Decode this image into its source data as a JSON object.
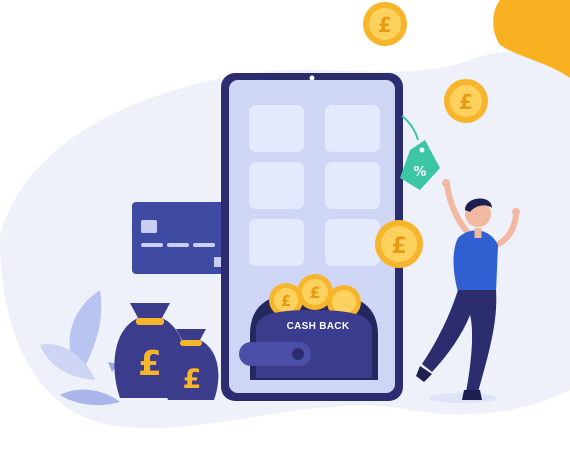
{
  "banner": {
    "cashback_label": "CASH BACK",
    "currency_symbol": "£",
    "percent_symbol": "%"
  },
  "colors": {
    "blob": "#eef0fa",
    "accent_yellow": "#f9b121",
    "phone_frame": "#2b2d6e",
    "phone_screen": "#cfd6f5",
    "tile": "#e4e9fb",
    "coin": "#f7b52b",
    "coin_inner": "#fcd15e",
    "bag": "#3b3d8c",
    "card": "#3f4ba3",
    "tag": "#3cc6a5",
    "person_shirt": "#2f5fd0",
    "person_pants": "#2b2d6e"
  },
  "icons": [
    "credit-card-icon",
    "money-bag-icon",
    "coin-icon",
    "discount-tag-icon",
    "wallet-icon",
    "plant-icon",
    "person-cheering-icon"
  ]
}
